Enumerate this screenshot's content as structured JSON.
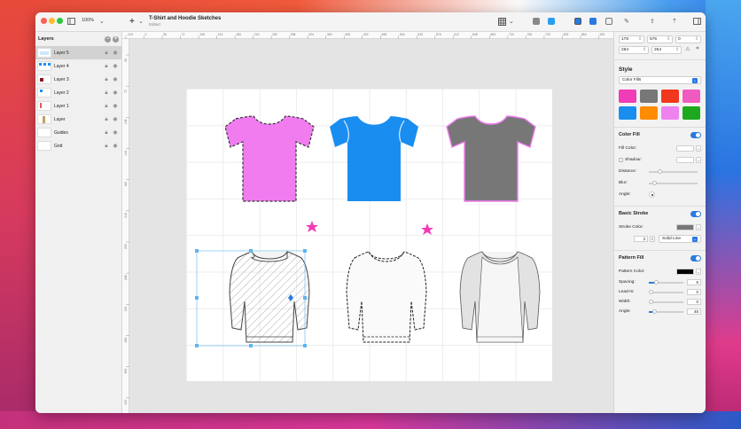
{
  "app": {
    "zoom": "100%",
    "doc_title": "T-Shirt and Hoodie Sketches",
    "doc_subtitle": "Edited"
  },
  "layers": {
    "title": "Layers",
    "items": [
      {
        "label": "Layer 5",
        "selected": true
      },
      {
        "label": "Layer 4",
        "selected": false
      },
      {
        "label": "Layer 3",
        "selected": false
      },
      {
        "label": "Layer 2",
        "selected": false
      },
      {
        "label": "Layer 1",
        "selected": false
      },
      {
        "label": "Layer",
        "selected": false
      },
      {
        "label": "Guides",
        "selected": false
      },
      {
        "label": "Grid",
        "selected": false
      }
    ]
  },
  "ruler": {
    "top_ticks": [
      "-124",
      "0",
      "36",
      "72",
      "108",
      "144",
      "180",
      "216",
      "252",
      "288",
      "324",
      "360",
      "396",
      "432",
      "468",
      "504",
      "540",
      "576",
      "612",
      "648",
      "684",
      "720",
      "756",
      "792",
      "828",
      "864",
      "900"
    ],
    "left_ticks": [
      "36",
      "72",
      "108",
      "144",
      "180",
      "216",
      "252",
      "288",
      "324",
      "360",
      "396",
      "432"
    ]
  },
  "inspector": {
    "x": "178",
    "y": "575",
    "rot": "0",
    "w": "254",
    "h": "254",
    "style_title": "Style",
    "fill_type": "Color Fills",
    "swatch_colors": [
      "#f03cb8",
      "#777777",
      "#f0381e",
      "#f05bc0",
      "#1a8ef0",
      "#ff8c00",
      "#ee82ee",
      "#1ea81e"
    ],
    "color_fill": {
      "title": "Color Fill",
      "fill_color": "Fill Color:",
      "shadow": "Shadow:",
      "distance": "Distance:",
      "blur": "Blur:",
      "angle": "Angle:"
    },
    "basic_stroke": {
      "title": "Basic Stroke",
      "stroke_color": "Stroke Color:",
      "width": "3",
      "line": "Solid Line"
    },
    "pattern_fill": {
      "title": "Pattern Fill",
      "pattern_color": "Pattern Color:",
      "spacing_label": "Spacing:",
      "spacing": "6",
      "leadin_label": "Lead-In:",
      "leadin": "0",
      "width_label": "Width:",
      "width": "0",
      "angle_label": "Angle:",
      "angle": "45"
    }
  },
  "colors": {
    "tshirt_pink": "#f07cf0",
    "tshirt_blue": "#1a8ef0",
    "tshirt_gray": "#777777",
    "star": "#f03cb8",
    "accent": "#2a7ae2"
  }
}
